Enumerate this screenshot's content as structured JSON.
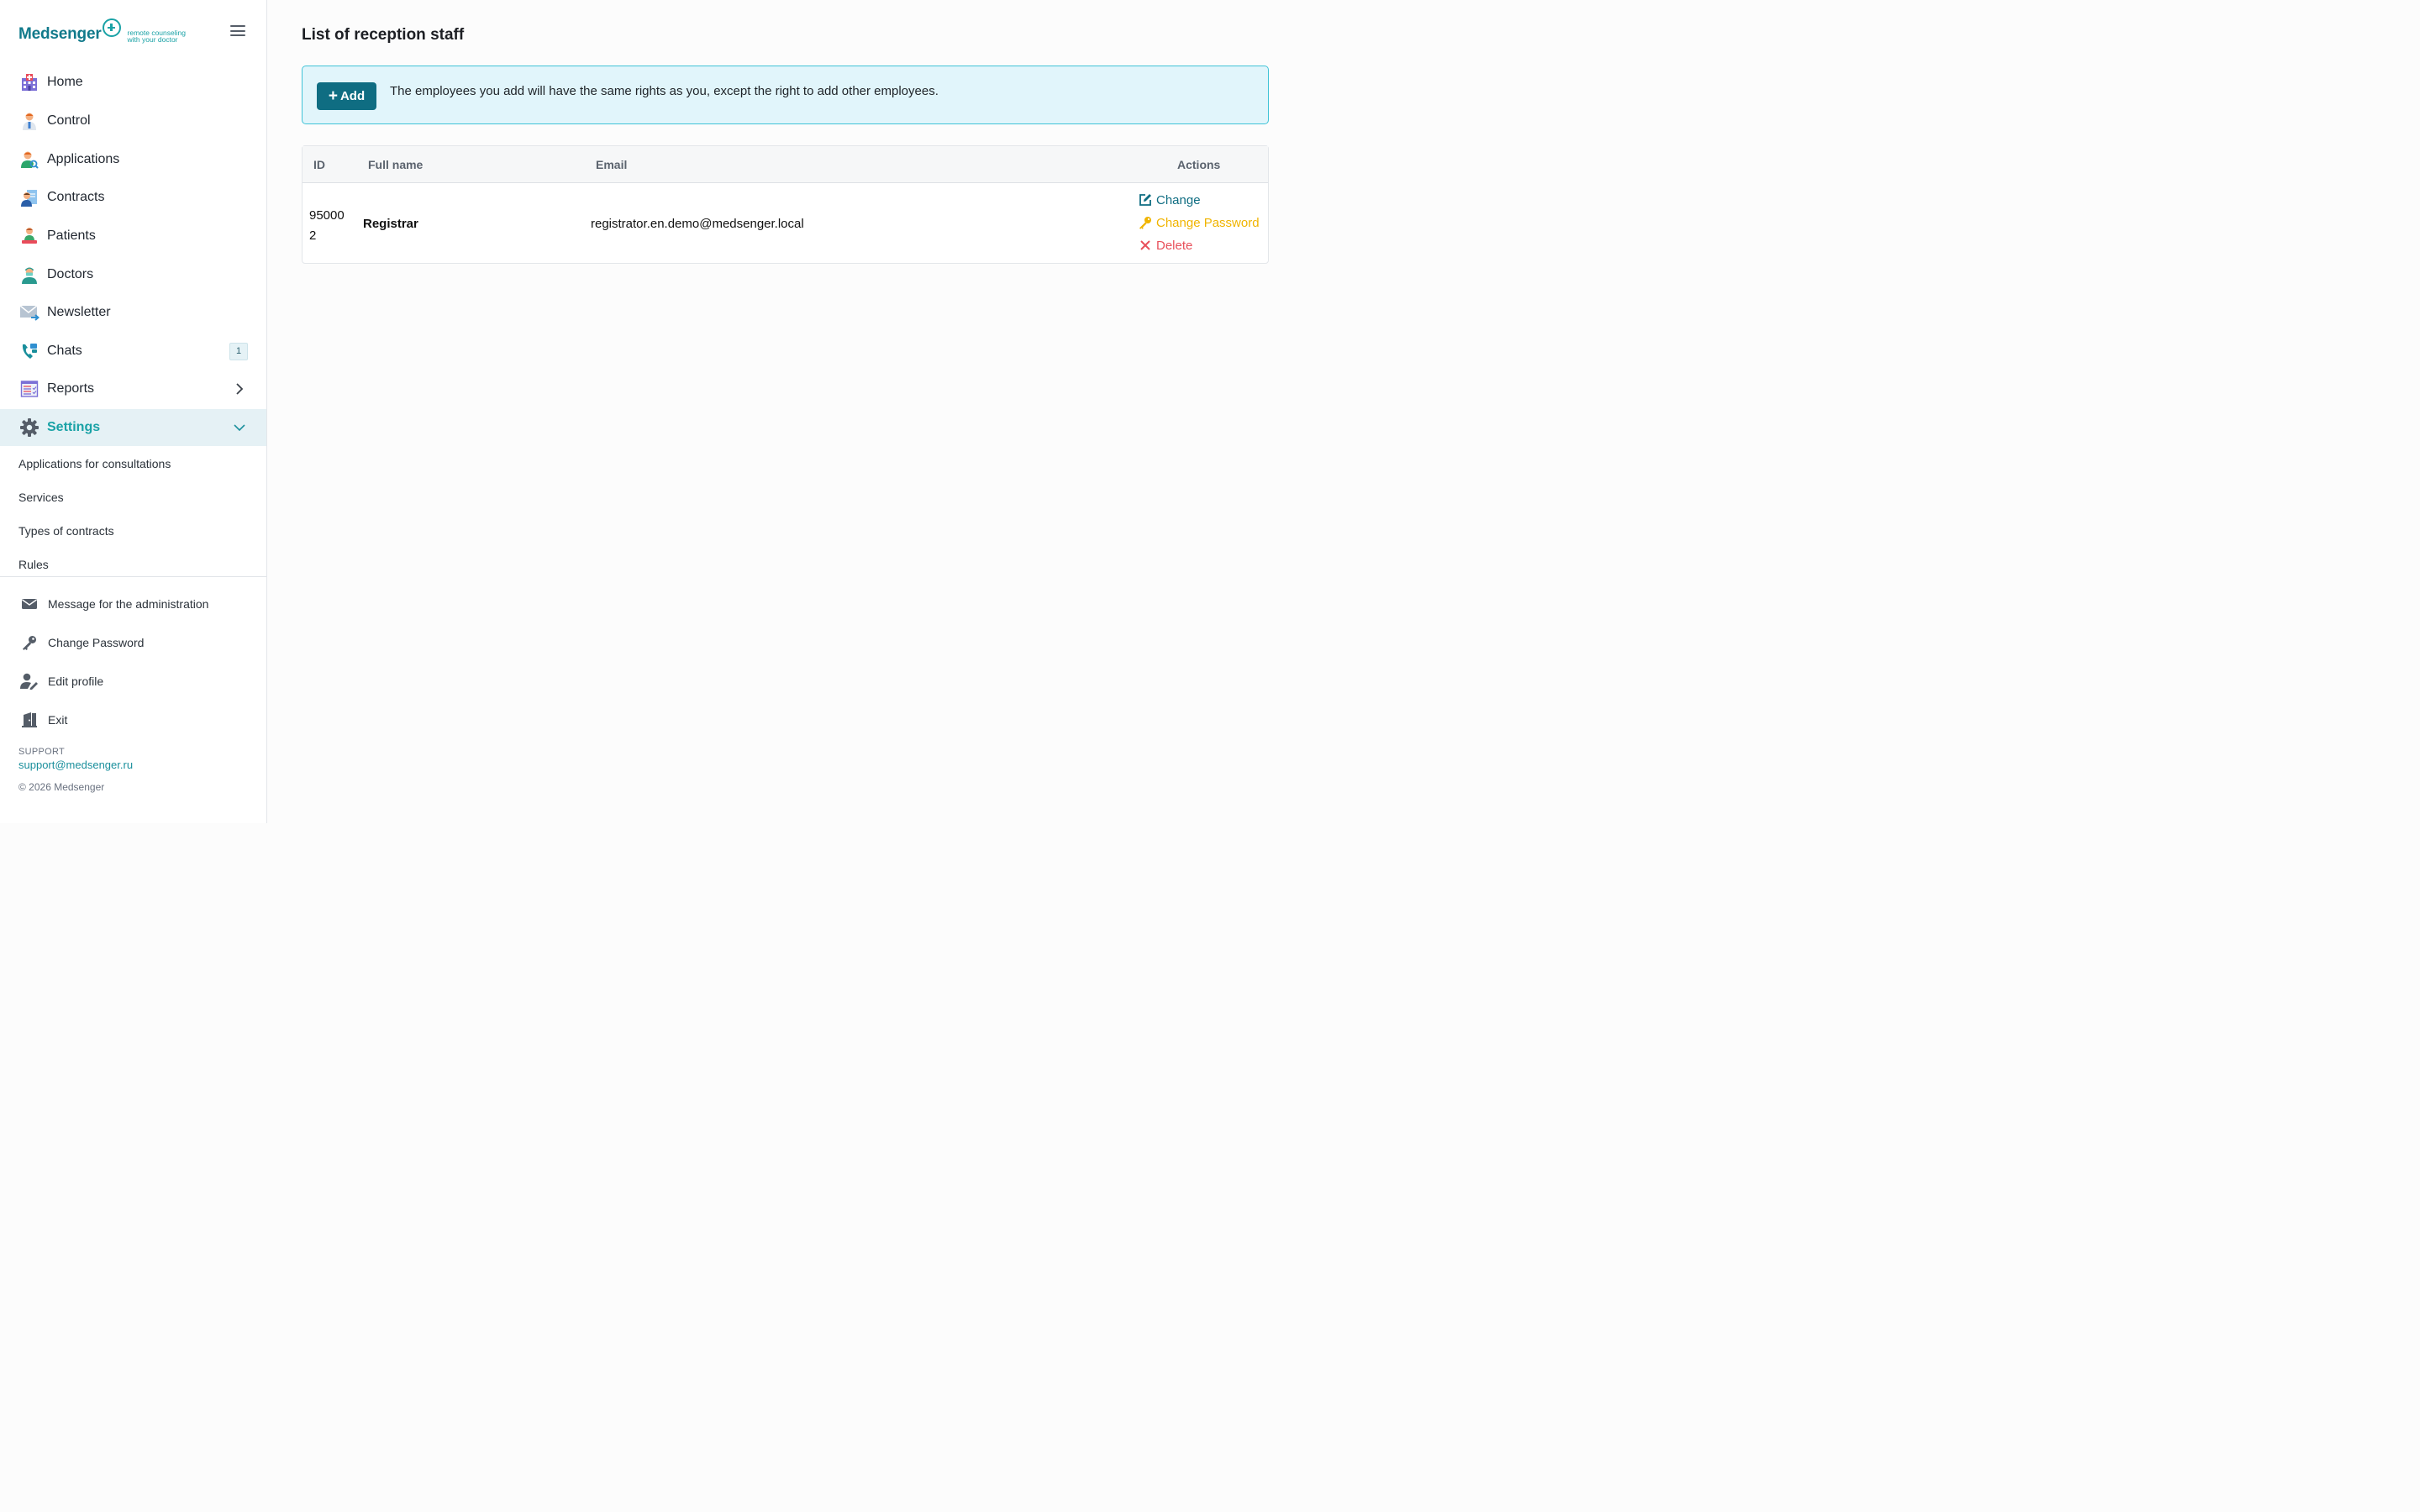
{
  "brand": {
    "name": "Medsenger",
    "tagline_line1": "remote counseling",
    "tagline_line2": "with your doctor"
  },
  "nav": {
    "items": [
      {
        "label": "Home",
        "icon": "hospital-icon"
      },
      {
        "label": "Control",
        "icon": "doctor-icon"
      },
      {
        "label": "Applications",
        "icon": "user-search-icon"
      },
      {
        "label": "Contracts",
        "icon": "contract-icon"
      },
      {
        "label": "Patients",
        "icon": "patient-icon"
      },
      {
        "label": "Doctors",
        "icon": "doctor-mask-icon"
      },
      {
        "label": "Newsletter",
        "icon": "envelope-icon"
      },
      {
        "label": "Chats",
        "icon": "phone-chat-icon",
        "badge": "1"
      },
      {
        "label": "Reports",
        "icon": "report-icon"
      },
      {
        "label": "Settings",
        "icon": "gear-icon",
        "active": true
      }
    ],
    "settings_sub": [
      "Applications for consultations",
      "Services",
      "Types of contracts",
      "Rules"
    ],
    "footer_items": [
      {
        "label": "Message for the administration",
        "icon": "mail-icon"
      },
      {
        "label": "Change Password",
        "icon": "key-icon"
      },
      {
        "label": "Edit profile",
        "icon": "user-edit-icon"
      },
      {
        "label": "Exit",
        "icon": "door-exit-icon"
      }
    ]
  },
  "support": {
    "label": "SUPPORT",
    "email": "support@medsenger.ru",
    "copyright": "© 2026 Medsenger"
  },
  "page": {
    "title": "List of reception staff",
    "add_label": "Add",
    "info_text": "The employees you add will have the same rights as you, except the right to add other employees."
  },
  "table": {
    "headers": {
      "id": "ID",
      "name": "Full name",
      "email": "Email",
      "actions": "Actions"
    },
    "rows": [
      {
        "id_line1": "95000",
        "id_line2": "2",
        "name": "Registrar",
        "email": "registrator.en.demo@medsenger.local",
        "actions": {
          "change": "Change",
          "password": "Change Password",
          "delete": "Delete"
        }
      }
    ]
  },
  "colors": {
    "accent": "#1aa2a6",
    "primary_button": "#0f6d82",
    "change": "#0f6d82",
    "password": "#f0b400",
    "delete": "#e8505b"
  }
}
